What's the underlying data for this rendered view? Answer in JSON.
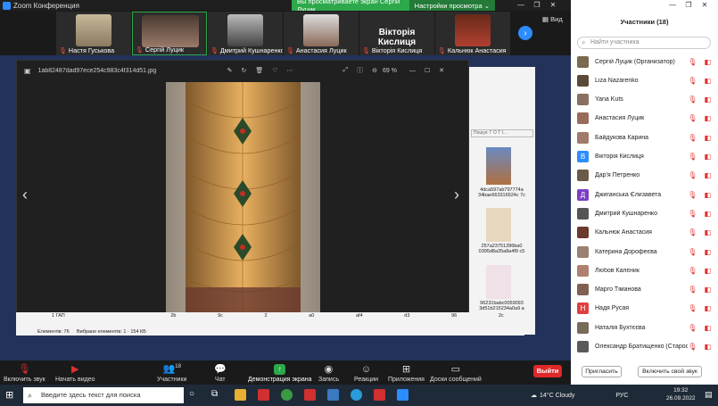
{
  "window": {
    "title": "Zoom Конференция"
  },
  "banner": {
    "viewing": "Вы просматриваете экран Сергій Луцик",
    "options": "Настройки просмотра"
  },
  "strip": {
    "view": "Вид",
    "tiles": [
      {
        "name": "Настя Гуськова"
      },
      {
        "name": "Сергій Луцик"
      },
      {
        "name": "Дмитрий Кушнаренко"
      },
      {
        "name": "Анастасия Луцик"
      },
      {
        "name": "Вікторія Кислиця",
        "big": "Вікторія Кислиця"
      },
      {
        "name": "Кальнюк Анастасия"
      }
    ]
  },
  "viewer": {
    "filename": "1ab82487dad97ece254c983c4f314d51.jpg",
    "zoom": "69 %"
  },
  "explorer": {
    "items": [
      "4dca597ab797774a 34bae663316524c 7c",
      "257a23751286ba0 0395d8a35a8a4f9 c5",
      "96231babc0059093 3d51b215234a0a9 a"
    ],
    "search": "Пошук: Г О Т І...",
    "labels": [
      "2b",
      "9c",
      "2",
      "a0",
      "af4",
      "d3",
      "96",
      "2c"
    ],
    "status_elements": "Елементів: 76",
    "status_selected": "Вибрано елементів: 1 · 154 КБ",
    "folder": "1 ГАП"
  },
  "toolbar": {
    "audio": "Включить звук",
    "video": "Начать видео",
    "participants": "Участники",
    "participants_count": "18",
    "chat": "Чат",
    "share": "Демонстрация экрана",
    "record": "Запись",
    "reactions": "Реакции",
    "apps": "Приложения",
    "whiteboard": "Доски сообщений",
    "leave": "Выйти"
  },
  "panel": {
    "title": "Участники (18)",
    "search_placeholder": "Найти участника",
    "invite": "Пригласить",
    "unmute_me": "Включить свой звук",
    "participants": [
      {
        "name": "Сергій Луцик (Организатор)",
        "color": "#7a6a4f"
      },
      {
        "name": "Liza Nazarenko",
        "color": "#5a4a3a"
      },
      {
        "name": "Yana Kuts",
        "color": "#8a7060"
      },
      {
        "name": "Анастасия Луцик",
        "color": "#9a6a5a"
      },
      {
        "name": "Байдукова Карина",
        "color": "#a07a6a"
      },
      {
        "name": "Вікторія Кислиця",
        "color": "#2d8cff",
        "letter": "В"
      },
      {
        "name": "Дар'я Петренко",
        "color": "#6a5a4a"
      },
      {
        "name": "Джиганська Єлизавета",
        "color": "#7b3fc4",
        "letter": "Д"
      },
      {
        "name": "Дмитрий Кушнаренко",
        "color": "#555"
      },
      {
        "name": "Кальнюк Анастасия",
        "color": "#6a3a2a"
      },
      {
        "name": "Катерина Дорофеєва",
        "color": "#9a8070"
      },
      {
        "name": "Любов Калєник",
        "color": "#b08070"
      },
      {
        "name": "Марго Тіманова",
        "color": "#806050"
      },
      {
        "name": "Надя Русая",
        "color": "#e04040",
        "letter": "Н"
      },
      {
        "name": "Наталія Бухтєєва",
        "color": "#7a6a5a"
      },
      {
        "name": "Олександр Братищенко (Старос...",
        "color": "#5a5a5a"
      }
    ]
  },
  "taskbar": {
    "search": "Введите здесь текст для поиска",
    "weather": "14°C  Cloudy",
    "lang": "РУС",
    "time": "19:32",
    "date": "26.09.2022"
  }
}
